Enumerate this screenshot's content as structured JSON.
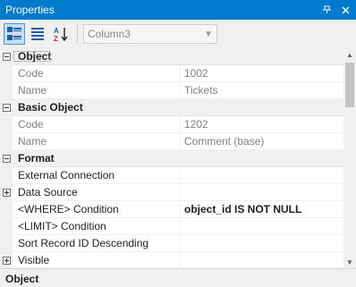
{
  "window": {
    "title": "Properties"
  },
  "toolbar": {
    "combo_value": "Column3"
  },
  "categories": [
    {
      "label": "Object",
      "expanded": true,
      "props": [
        {
          "name": "Code",
          "value": "1002",
          "readonly": true
        },
        {
          "name": "Name",
          "value": "Tickets",
          "readonly": true
        }
      ]
    },
    {
      "label": "Basic Object",
      "expanded": true,
      "props": [
        {
          "name": "Code",
          "value": "1202",
          "readonly": true
        },
        {
          "name": "Name",
          "value": "Comment (base)",
          "readonly": true
        }
      ]
    },
    {
      "label": "Format",
      "expanded": true,
      "props": [
        {
          "name": "External Connection",
          "value": ""
        },
        {
          "name": "Data Source",
          "value": "",
          "expandable": true
        },
        {
          "name": "<WHERE> Condition",
          "value": "object_id IS NOT NULL",
          "bold": true
        },
        {
          "name": "<LIMIT> Condition",
          "value": ""
        },
        {
          "name": "Sort Record ID Descending",
          "value": ""
        },
        {
          "name": "Visible",
          "value": "",
          "expandable": true
        }
      ]
    }
  ],
  "description": {
    "title": "Object"
  },
  "colors": {
    "titlebar": "#007acc",
    "category_bg": "#f0f0f0",
    "readonly_text": "#808080"
  }
}
